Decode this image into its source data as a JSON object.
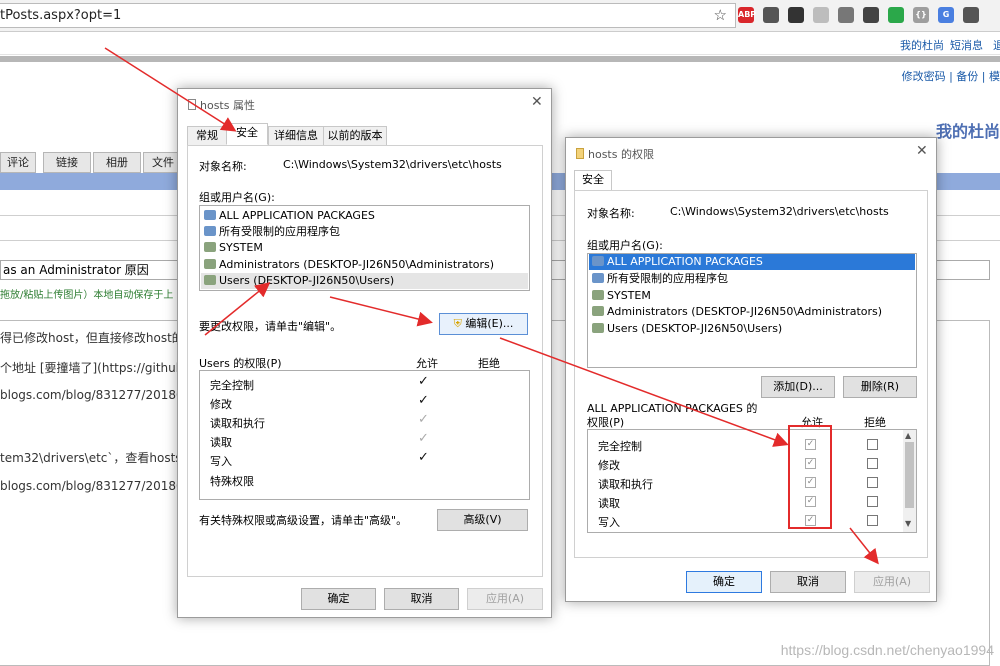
{
  "browser": {
    "url": "tPosts.aspx?opt=1",
    "extensions": [
      {
        "name": "abp-icon",
        "color": "#d9262b",
        "label": "ABP"
      },
      {
        "name": "grid-extension-icon",
        "color": "#555555",
        "label": ""
      },
      {
        "name": "qr-code-icon",
        "color": "#333333",
        "label": ""
      },
      {
        "name": "window-icon",
        "color": "#bdbdbd",
        "label": ""
      },
      {
        "name": "vpn-icon",
        "color": "#777777",
        "label": ""
      },
      {
        "name": "evernote-icon",
        "color": "#444444",
        "label": ""
      },
      {
        "name": "color-extension-icon",
        "color": "#2ba84a",
        "label": ""
      },
      {
        "name": "json-icon",
        "color": "#9e9e9e",
        "label": "{}"
      },
      {
        "name": "translate-icon",
        "color": "#4a7fe0",
        "label": "G"
      },
      {
        "name": "menu-icon",
        "color": "#555555",
        "label": ""
      }
    ]
  },
  "blog": {
    "topnav": [
      "我的杜尚",
      "短消息",
      "退"
    ],
    "subnav": "修改密码 | 备份 | 模",
    "title": "我的杜尚",
    "tabs": [
      "评论",
      "链接",
      "相册",
      "文件"
    ],
    "post_title": "as an Administrator 原因",
    "upload_hint": "拖放/粘贴上传图片）本地自动保存于上",
    "content_lines": [
      "得已修改host，但直接修改host的",
      "个地址 [要撞墙了](https://github.co",
      "blogs.com/blog/831277/201808/8",
      "tem32\\drivers\\etc`，查看hosts文件",
      "blogs.com/blog/831277/201808/8"
    ]
  },
  "props_dialog": {
    "title": "hosts 属性",
    "tabs": [
      "常规",
      "安全",
      "详细信息",
      "以前的版本"
    ],
    "object_label": "对象名称:",
    "object_path": "C:\\Windows\\System32\\drivers\\etc\\hosts",
    "group_label": "组或用户名(G):",
    "groups": [
      "ALL APPLICATION PACKAGES",
      "所有受限制的应用程序包",
      "SYSTEM",
      "Administrators (DESKTOP-JI26N50\\Administrators)",
      "Users (DESKTOP-JI26N50\\Users)"
    ],
    "change_hint": "要更改权限，请单击\"编辑\"。",
    "edit_button": "编辑(E)...",
    "perm_label": "Users 的权限(P)",
    "allow_header": "允许",
    "deny_header": "拒绝",
    "permissions": [
      "完全控制",
      "修改",
      "读取和执行",
      "读取",
      "写入",
      "特殊权限"
    ],
    "allow_checks": [
      "black",
      "black",
      "grey",
      "grey",
      "black",
      "none"
    ],
    "advanced_hint": "有关特殊权限或高级设置，请单击\"高级\"。",
    "advanced_button": "高级(V)",
    "ok": "确定",
    "cancel": "取消",
    "apply": "应用(A)"
  },
  "perm_dialog": {
    "title": "hosts 的权限",
    "tab": "安全",
    "object_label": "对象名称:",
    "object_path": "C:\\Windows\\System32\\drivers\\etc\\hosts",
    "group_label": "组或用户名(G):",
    "groups": [
      "ALL APPLICATION PACKAGES",
      "所有受限制的应用程序包",
      "SYSTEM",
      "Administrators (DESKTOP-JI26N50\\Administrators)",
      "Users (DESKTOP-JI26N50\\Users)"
    ],
    "add_button": "添加(D)...",
    "remove_button": "删除(R)",
    "perm_label_1": "ALL APPLICATION PACKAGES 的",
    "perm_label_2": "权限(P)",
    "allow_header": "允许",
    "deny_header": "拒绝",
    "permissions": [
      "完全控制",
      "修改",
      "读取和执行",
      "读取",
      "写入"
    ],
    "ok": "确定",
    "cancel": "取消",
    "apply": "应用(A)"
  },
  "watermark": "https://blog.csdn.net/chenyao1994"
}
